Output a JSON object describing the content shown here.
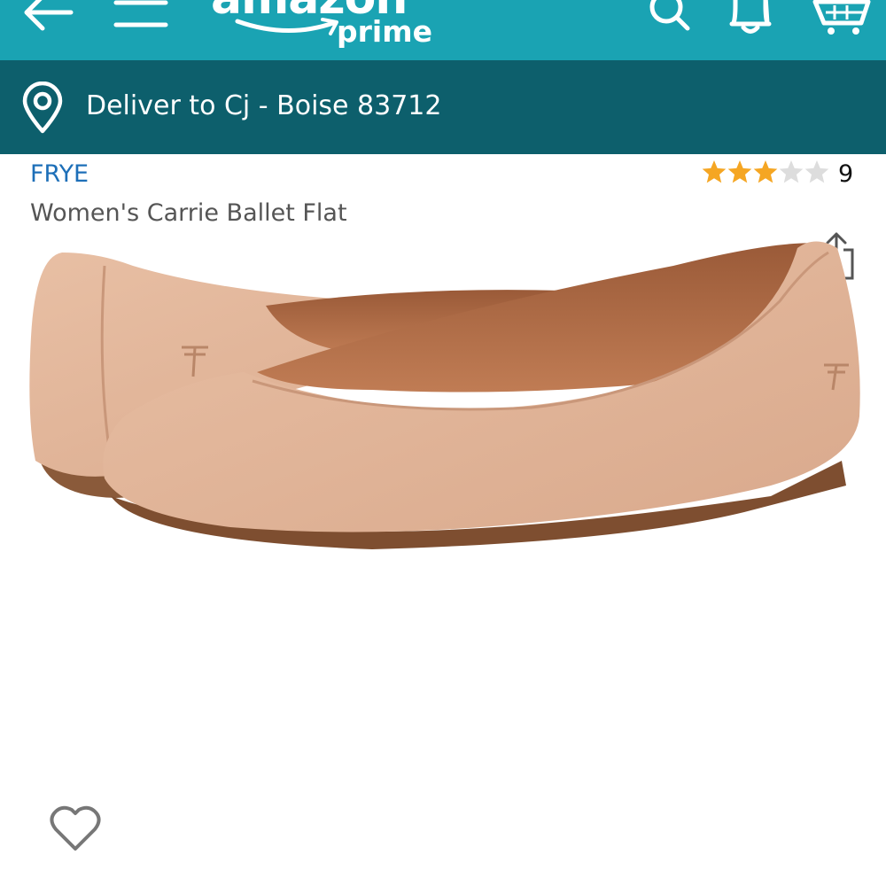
{
  "header": {
    "logo_word": "amazon",
    "logo_sub": "prime",
    "icons": [
      "back-arrow-icon",
      "menu-icon",
      "search-icon",
      "bell-icon",
      "cart-icon"
    ]
  },
  "delivery": {
    "text": "Deliver to Cj - Boise 83712",
    "icon": "location-pin-icon"
  },
  "product": {
    "brand": "FRYE",
    "title": "Women's Carrie Ballet Flat",
    "rating": 3,
    "rating_max": 5,
    "rating_count": "9",
    "image_alt": "product-image"
  },
  "actions": {
    "icons": [
      "share-icon",
      "heart-icon"
    ]
  },
  "colors": {
    "header_bg": "#1aa3b3",
    "deliver_bg": "#0d5f6c",
    "brand_link": "#1d6fb8",
    "star_filled": "#f5a623",
    "star_empty": "#dddddd"
  }
}
